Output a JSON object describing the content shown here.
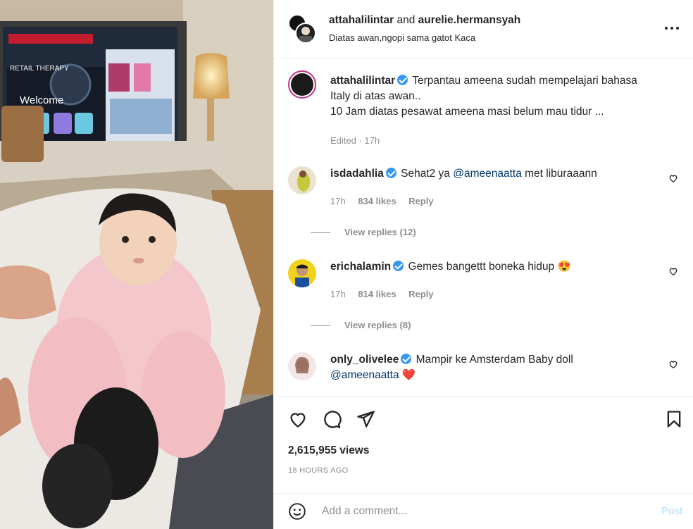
{
  "header": {
    "user1": "attahalilintar",
    "and_text": "and",
    "user2": "aurelie.hermansyah",
    "location": "Diatas awan,ngopi sama gatot Kaca"
  },
  "caption": {
    "username": "attahalilintar",
    "text_line1": "Terpantau ameena sudah mempelajari bahasa",
    "text_line2": "Italy di atas awan..",
    "text_line3": "10 Jam diatas pesawat ameena masi belum mau tidur ...",
    "meta": "Edited · 17h"
  },
  "comments": [
    {
      "username": "isdadahlia",
      "text_before": "Sehat2 ya ",
      "mention": "@ameenaatta",
      "text_after": " met liburaaann",
      "time": "17h",
      "likes": "834 likes",
      "reply": "Reply",
      "view_replies": "View replies (12)"
    },
    {
      "username": "erichalamin",
      "text_before": "Gemes bangettt boneka hidup ",
      "emoji": "😍",
      "time": "17h",
      "likes": "814 likes",
      "reply": "Reply",
      "view_replies": "View replies (8)"
    },
    {
      "username": "only_olivelee",
      "text_before": "Mampir ke Amsterdam Baby doll",
      "mention": "@ameenaatta",
      "emoji": "❤️"
    }
  ],
  "stats": {
    "views": "2,615,955 views",
    "posted": "18 HOURS AGO"
  },
  "comment_box": {
    "placeholder": "Add a comment...",
    "post_label": "Post"
  },
  "screen": {
    "welcome": "Welcome",
    "retail": "RETAIL THERAPY"
  },
  "colors": {
    "verified": "#3897f0",
    "mention": "#00376b",
    "post_disabled": "#b2dffc",
    "muted": "#8e8e8e"
  }
}
